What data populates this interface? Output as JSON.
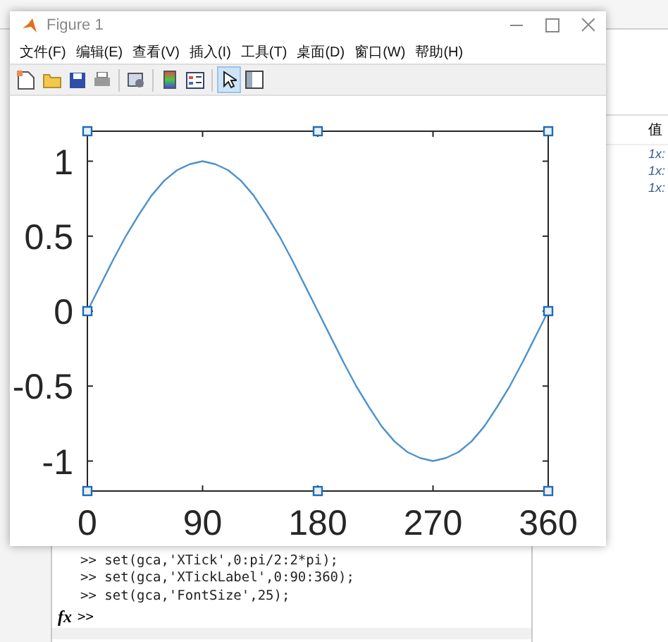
{
  "figure_window": {
    "title": "Figure 1",
    "menu": [
      "文件(F)",
      "编辑(E)",
      "查看(V)",
      "插入(I)",
      "工具(T)",
      "桌面(D)",
      "窗口(W)",
      "帮助(H)"
    ],
    "toolbar": [
      {
        "kind": "new",
        "selected": false
      },
      {
        "kind": "open",
        "selected": false
      },
      {
        "kind": "save",
        "selected": false
      },
      {
        "kind": "print",
        "selected": false
      },
      {
        "kind": "link",
        "selected": false
      },
      {
        "kind": "colorbar",
        "selected": false
      },
      {
        "kind": "legend",
        "selected": false
      },
      {
        "kind": "pointer",
        "selected": true
      },
      {
        "kind": "inspector",
        "selected": false
      }
    ],
    "chart_data": {
      "type": "line",
      "xlim": [
        0,
        360
      ],
      "ylim": [
        -1.2,
        1.2
      ],
      "x": [
        0,
        10,
        20,
        30,
        40,
        50,
        60,
        70,
        80,
        90,
        100,
        110,
        120,
        130,
        140,
        150,
        160,
        170,
        180,
        190,
        200,
        210,
        220,
        230,
        240,
        250,
        260,
        270,
        280,
        290,
        300,
        310,
        320,
        330,
        340,
        350,
        360
      ],
      "xticks": [
        0,
        90,
        180,
        270,
        360
      ],
      "yticks": [
        1,
        0.5,
        0,
        -0.5,
        -1
      ],
      "series": [
        {
          "color": "#4d92cc",
          "values": [
            0,
            0.17,
            0.34,
            0.5,
            0.64,
            0.77,
            0.87,
            0.94,
            0.98,
            1,
            0.98,
            0.94,
            0.87,
            0.77,
            0.64,
            0.5,
            0.34,
            0.17,
            0,
            -0.17,
            -0.34,
            -0.5,
            -0.64,
            -0.77,
            -0.87,
            -0.94,
            -0.98,
            -1,
            -0.98,
            -0.94,
            -0.87,
            -0.77,
            -0.64,
            -0.5,
            -0.34,
            -0.17,
            0
          ]
        }
      ]
    }
  },
  "command_window": {
    "lines": [
      ">> set(gca,'XTick',0:pi/2:2*pi);",
      ">> set(gca,'XTickLabel',0:90:360);",
      ">> set(gca,'FontSize',25);"
    ],
    "prompt_icon": "fx",
    "prompt": ">>"
  },
  "workspace": {
    "column": "值",
    "rows": [
      "1x:",
      "1x:",
      "1x:"
    ]
  }
}
